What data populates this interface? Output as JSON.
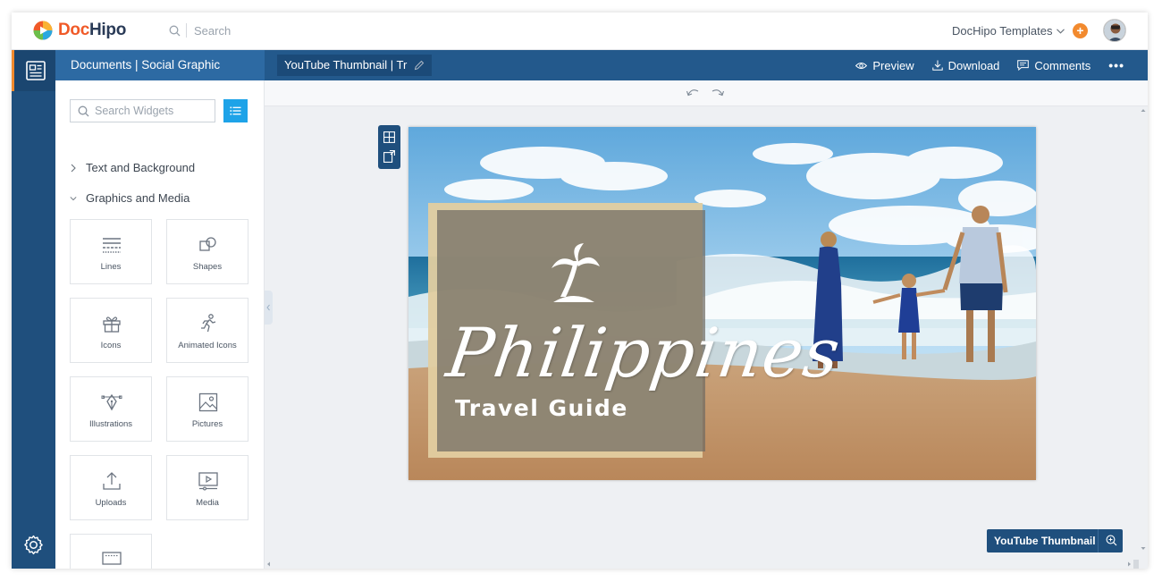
{
  "app": {
    "logo_doc": "Doc",
    "logo_hipo": "Hipo"
  },
  "topbar": {
    "search_placeholder": "Search",
    "templates_label": "DocHipo Templates",
    "plus_label": "+"
  },
  "header": {
    "breadcrumb": "Documents | Social Graphic",
    "doc_title": "YouTube Thumbnail | Tr",
    "actions": {
      "preview": "Preview",
      "download": "Download",
      "comments": "Comments",
      "more": "•••"
    }
  },
  "panel": {
    "search_placeholder": "Search Widgets",
    "sections": [
      "Text and Background",
      "Graphics and Media"
    ],
    "tiles": [
      {
        "label": "Lines",
        "icon": "lines-icon"
      },
      {
        "label": "Shapes",
        "icon": "shapes-icon"
      },
      {
        "label": "Icons",
        "icon": "gift-icon"
      },
      {
        "label": "Animated Icons",
        "icon": "running-figure-icon"
      },
      {
        "label": "Illustrations",
        "icon": "illustration-pen-icon"
      },
      {
        "label": "Pictures",
        "icon": "picture-icon"
      },
      {
        "label": "Uploads",
        "icon": "upload-icon"
      },
      {
        "label": "Media",
        "icon": "media-play-icon"
      }
    ]
  },
  "design": {
    "headline": "Philippines",
    "subheadline": "Travel Guide"
  },
  "canvas": {
    "size_badge": "YouTube Thumbnail"
  },
  "colors": {
    "brand_orange": "#f05a28",
    "brand_navy": "#2a3b57",
    "rail": "#1f4f7d",
    "header": "#23598c",
    "accent_blue": "#1ea3e8"
  }
}
